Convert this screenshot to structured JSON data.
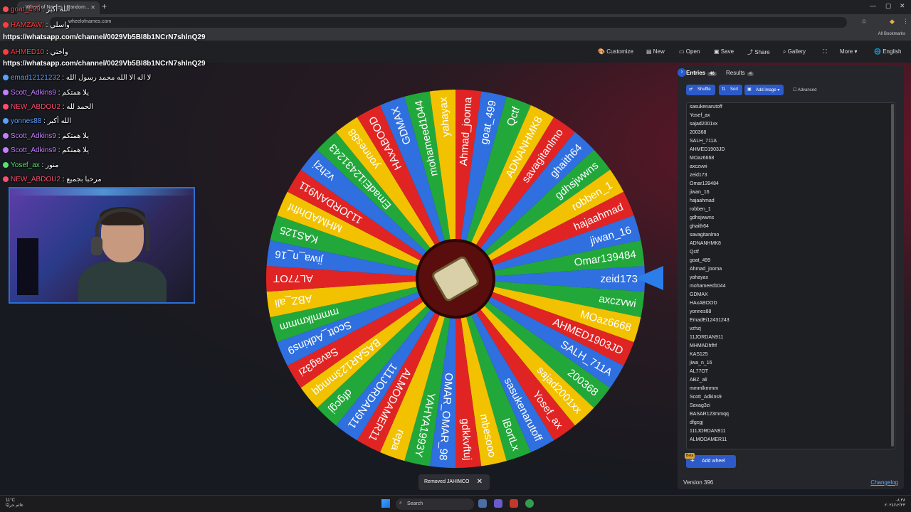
{
  "browser": {
    "tab_title": "Wheel of Names | Random...",
    "url": "wheelofnames.com",
    "all_bookmarks": "All Bookmarks"
  },
  "appbar": {
    "customize": "Customize",
    "new": "New",
    "open": "Open",
    "save": "Save",
    "share": "Share",
    "gallery": "Gallery",
    "more": "More",
    "language": "English"
  },
  "chat": {
    "whatsapp_link": "https://whatsapp.com/channel/0029Vb5BI8b1NCrN7shlnQ29",
    "messages": [
      {
        "user": "goat_499",
        "text": "الله أكبر",
        "color": "#ff4d4d"
      },
      {
        "user": "HAMZAWI",
        "text": "واسلي",
        "color": "#ff3b3b"
      },
      {
        "user": "AHMED10",
        "text": "واختي",
        "color": "#ff3b3b"
      },
      {
        "user": "emad12121232",
        "text": "لا اله الا الله محمد رسول الله",
        "color": "#5aa0ff"
      },
      {
        "user": "Scott_Adkins9",
        "text": "يلا همتكم",
        "color": "#c77dff"
      },
      {
        "user": "NEW_ABDOU2",
        "text": "الحمد لله",
        "color": "#ff4d6d"
      },
      {
        "user": "yonnes88",
        "text": "الله أكبر",
        "color": "#5aa0ff"
      },
      {
        "user": "Scott_Adkins9",
        "text": "يلا همتكم",
        "color": "#c77dff"
      },
      {
        "user": "Scott_Adkins9",
        "text": "يلا همتكم",
        "color": "#c77dff"
      },
      {
        "user": "Yosef_ax",
        "text": "منور",
        "color": "#58e06a"
      },
      {
        "user": "NEW_ABDOU2",
        "text": "مرحبا بجميع",
        "color": "#ff4d6d"
      }
    ]
  },
  "wheel": {
    "segments": [
      "zeid173",
      "axczvwi",
      "MOaz6668",
      "AHMED1903JD",
      "SALH_711A",
      "200368",
      "sajad2001xx",
      "Yosef_ax",
      "sasukenarutoff",
      "lBortLx",
      "mbesooo",
      "gdkkvftuj",
      "OMAR_OMAR_98",
      "YAHYA1993Y",
      "repa",
      "ALMODAMER11",
      "111JORDAN911",
      "dfgcgj",
      "BASAR123mmqq",
      "Savag3zi",
      "Scott_Adkins9",
      "mmmlkmmm",
      "ABZ_ali",
      "AL77OT",
      "jiwa_n_16",
      "KAS125",
      "MHMADhfhf",
      "11JORDAN911",
      "vzhzj",
      "EmadEi12431243",
      "yonnes88",
      "HAxABOOD",
      "GDMAX",
      "mohameed1044",
      "yahayax",
      "Ahmad_jooma",
      "goat_499",
      "Qctf",
      "ADNANHMK8",
      "savagitanlmo",
      "ghaith64",
      "gdhsjwwns",
      "robben_1",
      "hajaahmad",
      "jiwan_16",
      "Omar139484"
    ],
    "colors": [
      "#2f6fe0",
      "#22a83a",
      "#f2c200",
      "#e02424"
    ]
  },
  "panel": {
    "tab_entries": "Entries",
    "entries_count": "46",
    "tab_results": "Results",
    "results_count": "4",
    "shuffle": "Shuffle",
    "sort": "Sort",
    "add_image": "Add image",
    "advanced": "Advanced",
    "entries": [
      "sasukenarutoff",
      "Yosef_ax",
      "sajad2001xx",
      "200368",
      "SALH_711A",
      "AHMED1903JD",
      "MOaz6668",
      "axczvwi",
      "zeid173",
      "Omar139484",
      "jiwan_16",
      "hajaahmad",
      "robben_1",
      "gdhsjwwns",
      "ghaith64",
      "savagitanlmo",
      "ADNANHMK8",
      "Qctf",
      "goat_499",
      "Ahmad_jooma",
      "yahayax",
      "mohameed1044",
      "GDMAX",
      "HAxABOOD",
      "yonnes88",
      "EmadEi12431243",
      "vzhzj",
      "11JORDAN911",
      "MHMADhfhf",
      "KAS125",
      "jiwa_n_16",
      "AL77OT",
      "ABZ_ali",
      "mmmlkmmm",
      "Scott_Adkins9",
      "Savag3zi",
      "BASAR123mmqq",
      "dfgcgj",
      "111JORDAN911",
      "ALMODAMER11"
    ],
    "beta": "Beta",
    "add_wheel": "Add wheel",
    "version": "Version 396",
    "changelog": "Changelog"
  },
  "toast": {
    "text": "Removed JAHIMCO"
  },
  "taskbar": {
    "weather_temp": "11°C",
    "weather_text": "غائم جزئيًا",
    "search": "Search",
    "clock_line1": "٠٨:٣٨",
    "clock_line2": "٢٠٢٤/١٢/٢٣"
  }
}
